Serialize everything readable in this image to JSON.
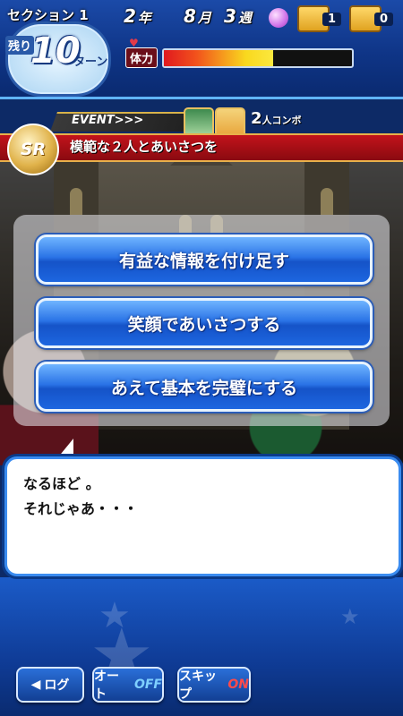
{
  "hud": {
    "section_label": "セクション 1",
    "remaining_label": "残り",
    "turns_left": "10",
    "turn_unit": "ターン",
    "year": "2",
    "year_unit": "年",
    "month": "8",
    "month_unit": "月",
    "week": "3",
    "week_unit": "週",
    "chest_silver_count": "1",
    "chest_gold_count": "0",
    "stamina_label": "体力",
    "stamina_level": 0.58
  },
  "event": {
    "tag": "EVENT>>>",
    "rarity": "SR",
    "title": "模範な２人とあいさつを",
    "combo_number": "2",
    "combo_label": "人コンボ"
  },
  "choices": [
    {
      "label": "有益な情報を付け足す"
    },
    {
      "label": "笑顔であいさつする"
    },
    {
      "label": "あえて基本を完璧にする"
    }
  ],
  "dialogue": {
    "line1": "なるほど 。",
    "line2": "それじゃあ・・・"
  },
  "controls": {
    "log_label": "ログ",
    "auto_label": "オート",
    "auto_state": "OFF",
    "skip_label": "スキップ",
    "skip_state": "ON"
  },
  "colors": {
    "hud_blue": "#0f3587",
    "event_red": "#c2131b",
    "choice_blue": "#1553c8",
    "stamina_red": "#e0191f",
    "stamina_yellow": "#f9d81e"
  }
}
